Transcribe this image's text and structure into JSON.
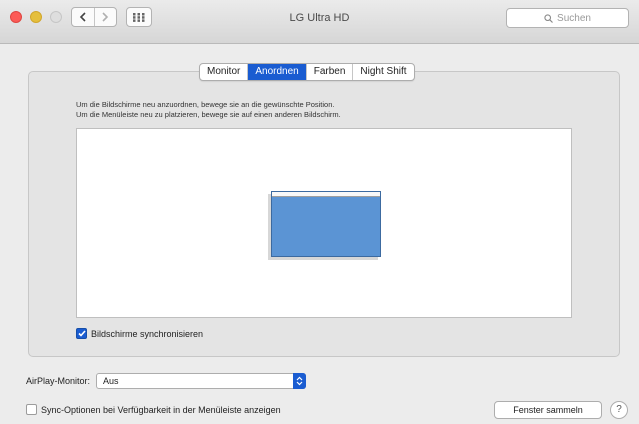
{
  "window": {
    "title": "LG Ultra HD",
    "search_placeholder": "Suchen"
  },
  "toolbar": {
    "icons": [
      "back-icon",
      "forward-icon",
      "grid-icon",
      "search-icon"
    ]
  },
  "tabs": [
    {
      "label": "Monitor",
      "active": false
    },
    {
      "label": "Anordnen",
      "active": true
    },
    {
      "label": "Farben",
      "active": false
    },
    {
      "label": "Night Shift",
      "active": false
    }
  ],
  "arrangement": {
    "instruction_1": "Um die Bildschirme neu anzuordnen, bewege sie an die gewünschte Position.",
    "instruction_2": "Um die Menüleiste neu zu platzieren, bewege sie auf einen anderen Bildschirm.",
    "mirror_label": "Bildschirme synchronisieren",
    "mirror_checked": true
  },
  "airplay": {
    "label": "AirPlay-Monitor:",
    "value": "Aus"
  },
  "sync_options": {
    "label": "Sync-Optionen bei Verfügbarkeit in der Menüleiste anzeigen",
    "checked": false
  },
  "buttons": {
    "gather_windows": "Fenster sammeln",
    "help": "?"
  },
  "colors": {
    "accent": "#1a5cd1",
    "display": "#5b94d4",
    "close": "#fc5b57",
    "minimize": "#e5bf3c"
  }
}
